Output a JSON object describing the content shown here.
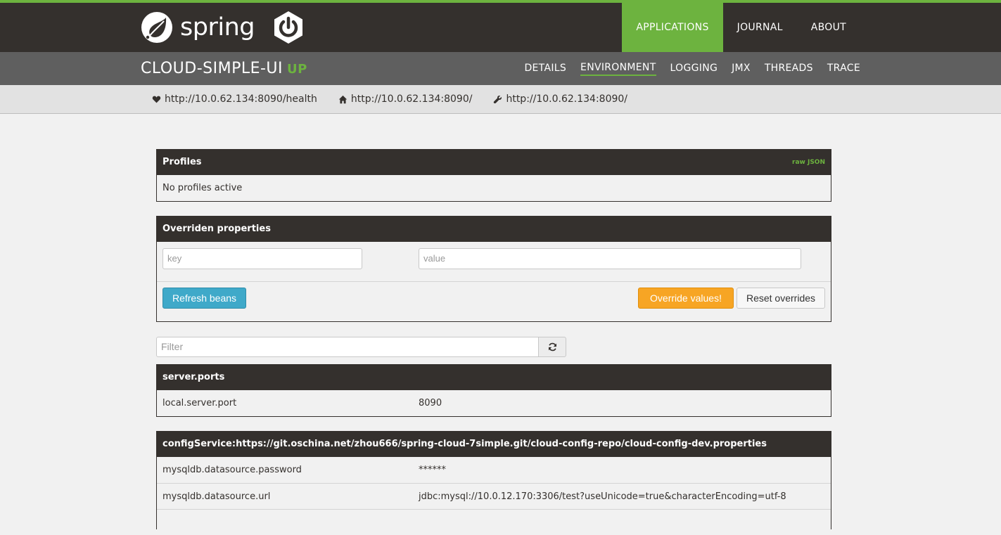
{
  "brand": {
    "name": "spring"
  },
  "topnav": [
    {
      "label": "APPLICATIONS",
      "active": true
    },
    {
      "label": "JOURNAL",
      "active": false
    },
    {
      "label": "ABOUT",
      "active": false
    }
  ],
  "app": {
    "name": "CLOUD-SIMPLE-UI",
    "status": "UP"
  },
  "subnav": [
    {
      "label": "DETAILS",
      "active": false
    },
    {
      "label": "ENVIRONMENT",
      "active": true
    },
    {
      "label": "LOGGING",
      "active": false
    },
    {
      "label": "JMX",
      "active": false
    },
    {
      "label": "THREADS",
      "active": false
    },
    {
      "label": "TRACE",
      "active": false
    }
  ],
  "urls": [
    {
      "icon": "heart-icon",
      "text": "http://10.0.62.134:8090/health"
    },
    {
      "icon": "home-icon",
      "text": "http://10.0.62.134:8090/"
    },
    {
      "icon": "wrench-icon",
      "text": "http://10.0.62.134:8090/"
    }
  ],
  "profiles": {
    "title": "Profiles",
    "raw_json": "raw JSON",
    "text": "No profiles active"
  },
  "overrides": {
    "title": "Overriden properties",
    "key_placeholder": "key",
    "value_placeholder": "value",
    "refresh_label": "Refresh beans",
    "override_label": "Override values!",
    "reset_label": "Reset overrides"
  },
  "filter": {
    "placeholder": "Filter"
  },
  "server_ports": {
    "title": "server.ports",
    "rows": [
      {
        "key": "local.server.port",
        "value": "8090"
      }
    ]
  },
  "config_service": {
    "title": "configService:https://git.oschina.net/zhou666/spring-cloud-7simple.git/cloud-config-repo/cloud-config-dev.properties",
    "rows": [
      {
        "key": "mysqldb.datasource.password",
        "value": "******"
      },
      {
        "key": "mysqldb.datasource.url",
        "value": "jdbc:mysql://10.0.12.170:3306/test?useUnicode=true&characterEncoding=utf-8"
      }
    ]
  },
  "colors": {
    "brand_green": "#6db33f",
    "header_dark": "#34302d",
    "appbar_grey": "#5f5f5f",
    "button_blue": "#3fa9c9",
    "button_orange": "#f7a524"
  }
}
